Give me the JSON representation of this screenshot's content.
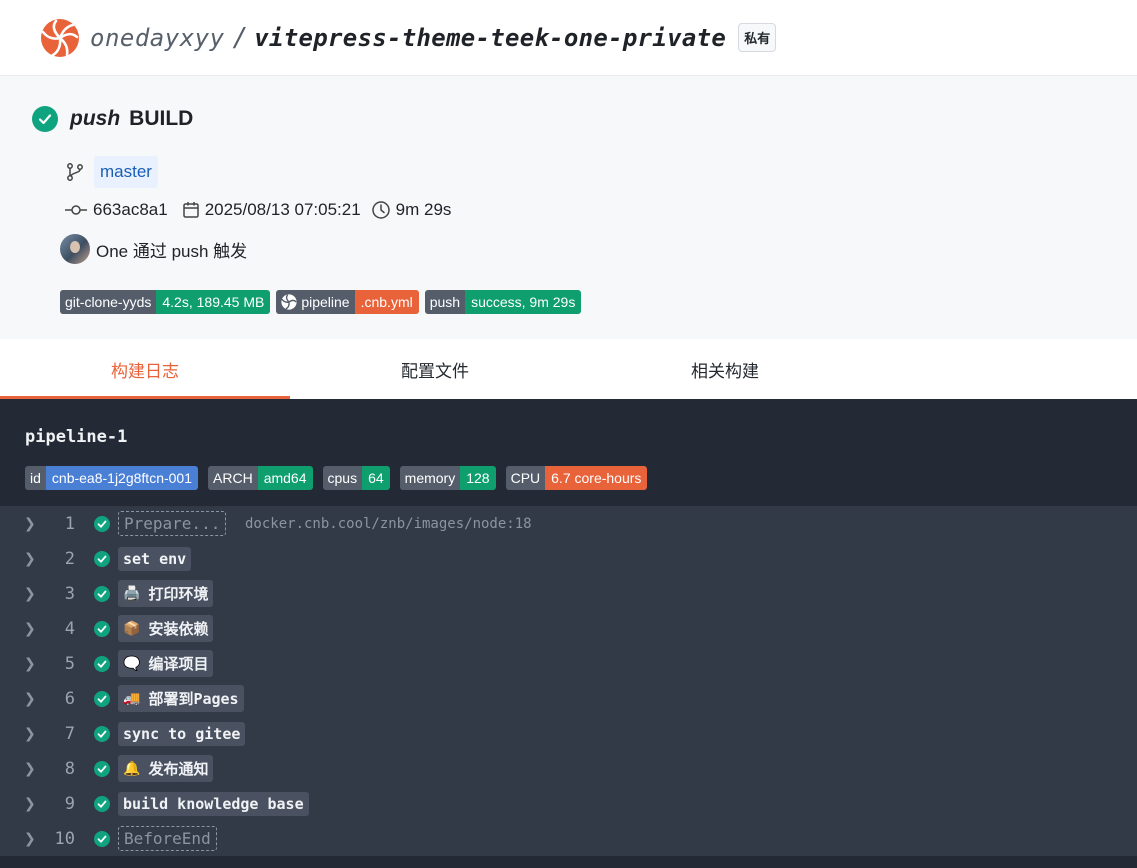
{
  "repo": {
    "owner": "onedayxyy",
    "separator": "/",
    "name": "vitepress-theme-teek-one-private",
    "visibility": "私有"
  },
  "build": {
    "event": "push",
    "title": "BUILD",
    "status": "success",
    "branch": "master",
    "commit": "663ac8a1",
    "datetime": "2025/08/13 07:05:21",
    "duration": "9m 29s",
    "trigger": "One 通过 push 触发"
  },
  "badges": [
    {
      "left": "git-clone-yyds",
      "right": "4.2s, 189.45 MB",
      "color": "#0f9f6e"
    },
    {
      "left": "pipeline",
      "right": ".cnb.yml",
      "color": "#e8623a"
    },
    {
      "left": "push",
      "right": "success, 9m 29s",
      "color": "#0f9f6e"
    }
  ],
  "tabs": [
    {
      "label": "构建日志",
      "active": true
    },
    {
      "label": "配置文件",
      "active": false
    },
    {
      "label": "相关构建",
      "active": false
    }
  ],
  "pipeline": {
    "name": "pipeline-1",
    "badges": [
      {
        "left": "id",
        "right": "cnb-ea8-1j2g8ftcn-001",
        "color": "#4a7fd6"
      },
      {
        "left": "ARCH",
        "right": "amd64",
        "color": "#0f9f6e"
      },
      {
        "left": "cpus",
        "right": "64",
        "color": "#0f9f6e"
      },
      {
        "left": "memory",
        "right": "128",
        "color": "#0f9f6e"
      },
      {
        "left": "CPU",
        "right": "6.7 core-hours",
        "color": "#e8623a"
      }
    ],
    "steps": [
      {
        "num": "1",
        "label": "Prepare...",
        "style": "dashed",
        "image": "docker.cnb.cool/znb/images/node:18"
      },
      {
        "num": "2",
        "label": "set env",
        "style": "solid"
      },
      {
        "num": "3",
        "label": "打印环境",
        "style": "solid",
        "emoji": "🖨️"
      },
      {
        "num": "4",
        "label": "安装依赖",
        "style": "solid",
        "emoji": "📦"
      },
      {
        "num": "5",
        "label": "编译项目",
        "style": "solid",
        "emoji": "🗨️"
      },
      {
        "num": "6",
        "label": "部署到Pages",
        "style": "solid",
        "emoji": "🚚"
      },
      {
        "num": "7",
        "label": "sync to gitee",
        "style": "solid"
      },
      {
        "num": "8",
        "label": "发布通知",
        "style": "solid",
        "emoji": "🔔"
      },
      {
        "num": "9",
        "label": "build knowledge base",
        "style": "solid"
      },
      {
        "num": "10",
        "label": "BeforeEnd",
        "style": "dashed"
      }
    ]
  }
}
